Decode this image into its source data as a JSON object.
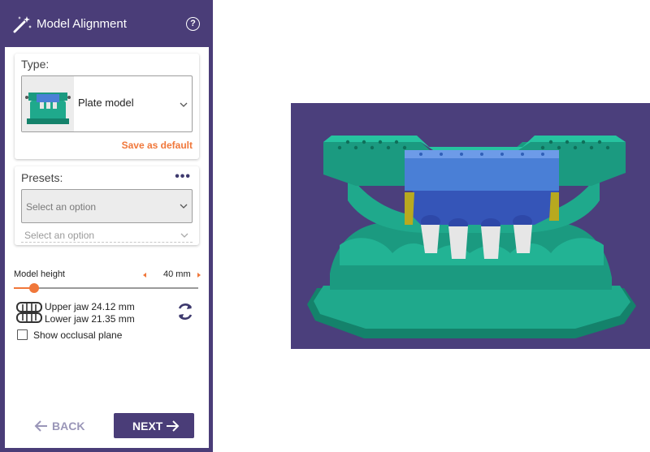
{
  "header": {
    "title": "Model Alignment",
    "help_icon": "help-circle-icon",
    "wand_icon": "magic-wand-icon",
    "help_glyph": "?"
  },
  "type_card": {
    "label": "Type:",
    "selected": "Plate model",
    "save_default": "Save as default"
  },
  "presets_card": {
    "label": "Presets:",
    "menu_glyph": "•••",
    "placeholder_main": "Select an option",
    "placeholder_sub": "Select an option"
  },
  "model_height": {
    "label": "Model height",
    "value": "40 mm",
    "slider_fraction": 0.11
  },
  "jaw": {
    "upper": "Upper jaw 24.12 mm",
    "lower": "Lower jaw 21.35 mm"
  },
  "occlusal": {
    "label": "Show occlusal plane",
    "checked": false
  },
  "footer": {
    "back_label": "BACK",
    "next_label": "NEXT"
  },
  "colors": {
    "accent": "#f0773a",
    "panel": "#4a3d78",
    "viewport_bg": "#4b3f7c",
    "model_green": "#1fa98c",
    "model_blue": "#4a7fd6"
  }
}
